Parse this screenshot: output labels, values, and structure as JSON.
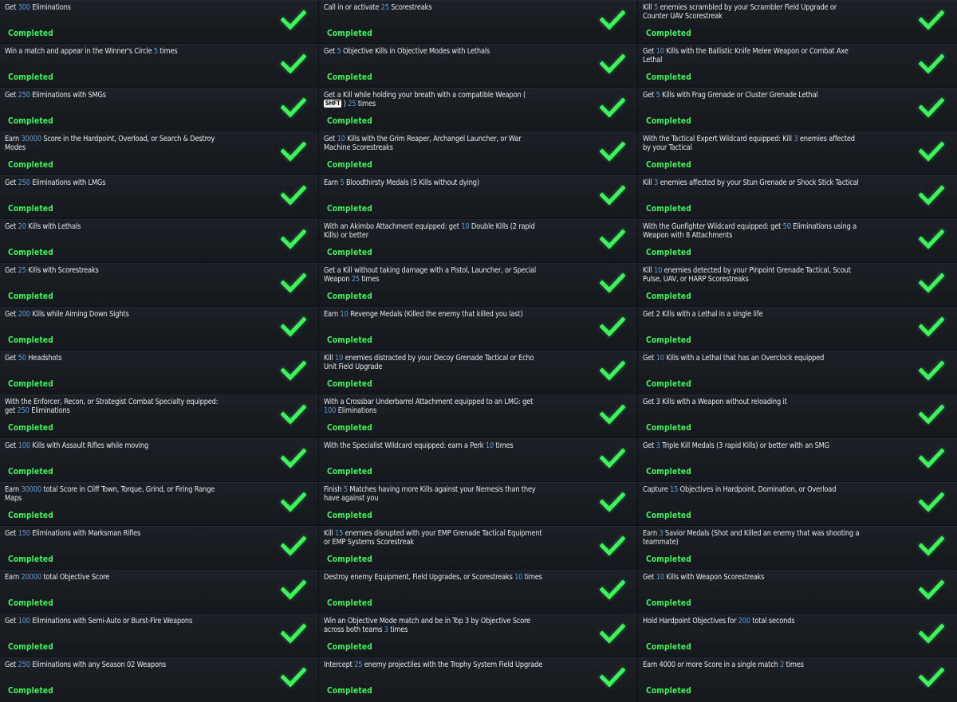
{
  "status_label": "Completed",
  "columns": [
    [
      {
        "parts": [
          [
            "Get ",
            0
          ],
          [
            "300",
            1
          ],
          [
            " Eliminations",
            0
          ]
        ]
      },
      {
        "parts": [
          [
            "Win a match and appear in the Winner's Circle ",
            0
          ],
          [
            "5",
            1
          ],
          [
            " times",
            0
          ]
        ]
      },
      {
        "parts": [
          [
            "Get ",
            0
          ],
          [
            "250",
            1
          ],
          [
            " Eliminations with SMGs",
            0
          ]
        ]
      },
      {
        "parts": [
          [
            "Earn ",
            0
          ],
          [
            "30000",
            1
          ],
          [
            " Score in the Hardpoint, Overload, or Search & Destroy Modes",
            0
          ]
        ]
      },
      {
        "parts": [
          [
            "Get ",
            0
          ],
          [
            "250",
            1
          ],
          [
            " Eliminations with LMGs",
            0
          ]
        ]
      },
      {
        "parts": [
          [
            "Get ",
            0
          ],
          [
            "20",
            1
          ],
          [
            " Kills with Lethals",
            0
          ]
        ]
      },
      {
        "parts": [
          [
            "Get ",
            0
          ],
          [
            "25",
            1
          ],
          [
            " Kills with Scorestreaks",
            0
          ]
        ]
      },
      {
        "parts": [
          [
            "Get ",
            0
          ],
          [
            "200",
            1
          ],
          [
            " Kills while Aiming Down Sights",
            0
          ]
        ]
      },
      {
        "parts": [
          [
            "Get ",
            0
          ],
          [
            "50",
            1
          ],
          [
            " Headshots",
            0
          ]
        ]
      },
      {
        "parts": [
          [
            "With the Enforcer, Recon, or Strategist Combat Specialty equipped: get ",
            0
          ],
          [
            "250",
            1
          ],
          [
            " Eliminations",
            0
          ]
        ]
      },
      {
        "parts": [
          [
            "Get ",
            0
          ],
          [
            "100",
            1
          ],
          [
            " Kills with Assault Rifles while moving",
            0
          ]
        ]
      },
      {
        "parts": [
          [
            "Earn ",
            0
          ],
          [
            "30000",
            1
          ],
          [
            " total Score in Cliff Town, Torque, Grind, or Firing Range Maps",
            0
          ]
        ]
      },
      {
        "parts": [
          [
            "Get ",
            0
          ],
          [
            "150",
            1
          ],
          [
            " Eliminations with Marksman Rifles",
            0
          ]
        ]
      },
      {
        "parts": [
          [
            "Earn ",
            0
          ],
          [
            "20000",
            1
          ],
          [
            " total Objective Score",
            0
          ]
        ]
      },
      {
        "parts": [
          [
            "Get ",
            0
          ],
          [
            "100",
            1
          ],
          [
            " Eliminations with Semi-Auto or Burst-Fire Weapons",
            0
          ]
        ]
      },
      {
        "parts": [
          [
            "Get ",
            0
          ],
          [
            "250",
            1
          ],
          [
            " Eliminations with any Season 02 Weapons",
            0
          ]
        ]
      }
    ],
    [
      {
        "parts": [
          [
            "Call in or activate ",
            0
          ],
          [
            "25",
            1
          ],
          [
            " Scorestreaks",
            0
          ]
        ]
      },
      {
        "parts": [
          [
            "Get ",
            0
          ],
          [
            "5",
            1
          ],
          [
            " Objective Kills in Objective Modes with Lethals",
            0
          ]
        ]
      },
      {
        "parts": [
          [
            "Get a Kill while holding your breath with a compatible Weapon ( ",
            0
          ],
          [
            "SHFT",
            2
          ],
          [
            " ) ",
            0
          ],
          [
            "25",
            1
          ],
          [
            " times",
            0
          ]
        ]
      },
      {
        "parts": [
          [
            "Get ",
            0
          ],
          [
            "10",
            1
          ],
          [
            " Kills with the Grim Reaper, Archangel Launcher, or War Machine Scorestreaks",
            0
          ]
        ]
      },
      {
        "parts": [
          [
            "Earn ",
            0
          ],
          [
            "5",
            1
          ],
          [
            " Bloodthirsty Medals (5 Kills without dying)",
            0
          ]
        ]
      },
      {
        "parts": [
          [
            "With an Akimbo Attachment equipped: get ",
            0
          ],
          [
            "10",
            1
          ],
          [
            " Double Kills (2 rapid Kills) or better",
            0
          ]
        ]
      },
      {
        "parts": [
          [
            "Get a Kill without taking damage with a Pistol, Launcher, or Special Weapon ",
            0
          ],
          [
            "25",
            1
          ],
          [
            " times",
            0
          ]
        ]
      },
      {
        "parts": [
          [
            "Earn ",
            0
          ],
          [
            "10",
            1
          ],
          [
            " Revenge Medals (Killed the enemy that killed you last)",
            0
          ]
        ]
      },
      {
        "parts": [
          [
            "Kill ",
            0
          ],
          [
            "10",
            1
          ],
          [
            " enemies distracted by your Decoy Grenade Tactical or Echo Unit Field Upgrade",
            0
          ]
        ]
      },
      {
        "parts": [
          [
            "With a Crossbar Underbarrel Attachment equipped to an LMG: get ",
            0
          ],
          [
            "100",
            1
          ],
          [
            " Eliminations",
            0
          ]
        ]
      },
      {
        "parts": [
          [
            "With the Specialist Wildcard equipped: earn a Perk ",
            0
          ],
          [
            "10",
            1
          ],
          [
            " times",
            0
          ]
        ]
      },
      {
        "parts": [
          [
            "Finish ",
            0
          ],
          [
            "5",
            1
          ],
          [
            " Matches having more Kills against your Nemesis than they have against you",
            0
          ]
        ]
      },
      {
        "parts": [
          [
            "Kill ",
            0
          ],
          [
            "15",
            1
          ],
          [
            " enemies disrupted with your EMP Grenade Tactical Equipment or EMP Systems Scorestreak",
            0
          ]
        ]
      },
      {
        "parts": [
          [
            "Destroy enemy Equipment, Field Upgrades, or Scorestreaks ",
            0
          ],
          [
            "10",
            1
          ],
          [
            " times",
            0
          ]
        ]
      },
      {
        "parts": [
          [
            "Win an Objective Mode match and be in Top 3 by Objective Score across both teams ",
            0
          ],
          [
            "3",
            1
          ],
          [
            " times",
            0
          ]
        ]
      },
      {
        "parts": [
          [
            "Intercept ",
            0
          ],
          [
            "25",
            1
          ],
          [
            " enemy projectiles with the Trophy System Field Upgrade",
            0
          ]
        ]
      }
    ],
    [
      {
        "parts": [
          [
            "Kill ",
            0
          ],
          [
            "5",
            1
          ],
          [
            " enemies scrambled by your Scrambler Field Upgrade or Counter UAV Scorestreak",
            0
          ]
        ]
      },
      {
        "parts": [
          [
            "Get ",
            0
          ],
          [
            "10",
            1
          ],
          [
            " Kills with the Ballistic Knife Melee Weapon or Combat Axe Lethal",
            0
          ]
        ]
      },
      {
        "parts": [
          [
            "Get ",
            0
          ],
          [
            "5",
            1
          ],
          [
            " Kills with Frag Grenade or Cluster Grenade Lethal",
            0
          ]
        ]
      },
      {
        "parts": [
          [
            "With the Tactical Expert Wildcard equipped: Kill ",
            0
          ],
          [
            "3",
            1
          ],
          [
            " enemies affected by your Tactical",
            0
          ]
        ]
      },
      {
        "parts": [
          [
            "Kill ",
            0
          ],
          [
            "3",
            1
          ],
          [
            " enemies affected by your Stun Grenade or Shock Stick Tactical",
            0
          ]
        ]
      },
      {
        "parts": [
          [
            "With the Gunfighter Wildcard equipped: get ",
            0
          ],
          [
            "50",
            1
          ],
          [
            " Eliminations using a Weapon with 8 Attachments",
            0
          ]
        ]
      },
      {
        "parts": [
          [
            "Kill ",
            0
          ],
          [
            "10",
            1
          ],
          [
            " enemies detected by your Pinpoint Grenade Tactical, Scout Pulse, UAV, or HARP Scorestreaks",
            0
          ]
        ]
      },
      {
        "parts": [
          [
            "Get 2 Kills with a Lethal in a single life",
            0
          ]
        ]
      },
      {
        "parts": [
          [
            "Get ",
            0
          ],
          [
            "10",
            1
          ],
          [
            " Kills with a Lethal that has an Overclock equipped",
            0
          ]
        ]
      },
      {
        "parts": [
          [
            "Get 3 Kills with a Weapon without reloading it",
            0
          ]
        ]
      },
      {
        "parts": [
          [
            "Get ",
            0
          ],
          [
            "3",
            1
          ],
          [
            " Triple Kill Medals (3 rapid Kills) or better with an SMG",
            0
          ]
        ]
      },
      {
        "parts": [
          [
            "Capture ",
            0
          ],
          [
            "15",
            1
          ],
          [
            " Objectives in Hardpoint, Domination, or Overload",
            0
          ]
        ]
      },
      {
        "parts": [
          [
            "Earn ",
            0
          ],
          [
            "3",
            1
          ],
          [
            " Savior Medals (Shot and Killed an enemy that was shooting a teammate)",
            0
          ]
        ]
      },
      {
        "parts": [
          [
            "Get ",
            0
          ],
          [
            "10",
            1
          ],
          [
            " Kills with Weapon Scorestreaks",
            0
          ]
        ]
      },
      {
        "parts": [
          [
            "Hold Hardpoint Objectives for ",
            0
          ],
          [
            "200",
            1
          ],
          [
            " total seconds",
            0
          ]
        ]
      },
      {
        "parts": [
          [
            "Earn 4000 or more Score in a single match ",
            0
          ],
          [
            "2",
            1
          ],
          [
            " times",
            0
          ]
        ]
      }
    ]
  ],
  "colors": {
    "highlight": "#5b9ad6",
    "completed": "#3df55a",
    "text": "#e6e7e9",
    "background": "#181c21"
  },
  "icons": {
    "status": "checkmark-icon"
  }
}
